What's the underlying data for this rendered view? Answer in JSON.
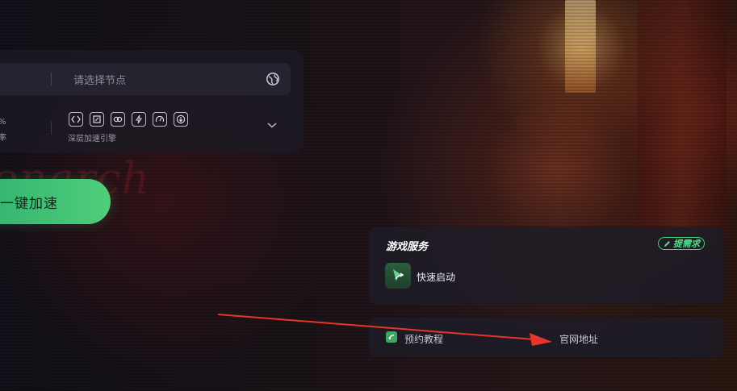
{
  "node_selector": {
    "placeholder": "请选择节点",
    "icon": "globe-icon"
  },
  "stats": {
    "percent_suffix": "%",
    "rate_suffix": "率"
  },
  "features": {
    "icons": [
      "code-icon",
      "window-icon",
      "link-icon",
      "bolt-icon",
      "speed-icon",
      "download-icon"
    ],
    "label": "深层加速引擎"
  },
  "accelerate_button": {
    "label": "一键加速"
  },
  "game_services": {
    "title": "游戏服务",
    "request_badge": "提需求",
    "items": [
      {
        "label": "快速启动",
        "icon": "quick-launch-icon"
      }
    ]
  },
  "links": {
    "tutorial": "预约教程",
    "official_site": "官网地址"
  },
  "background_logo": "onarch",
  "colors": {
    "accent_green": "#4fcf7a",
    "annotation_red": "#e8342a"
  }
}
